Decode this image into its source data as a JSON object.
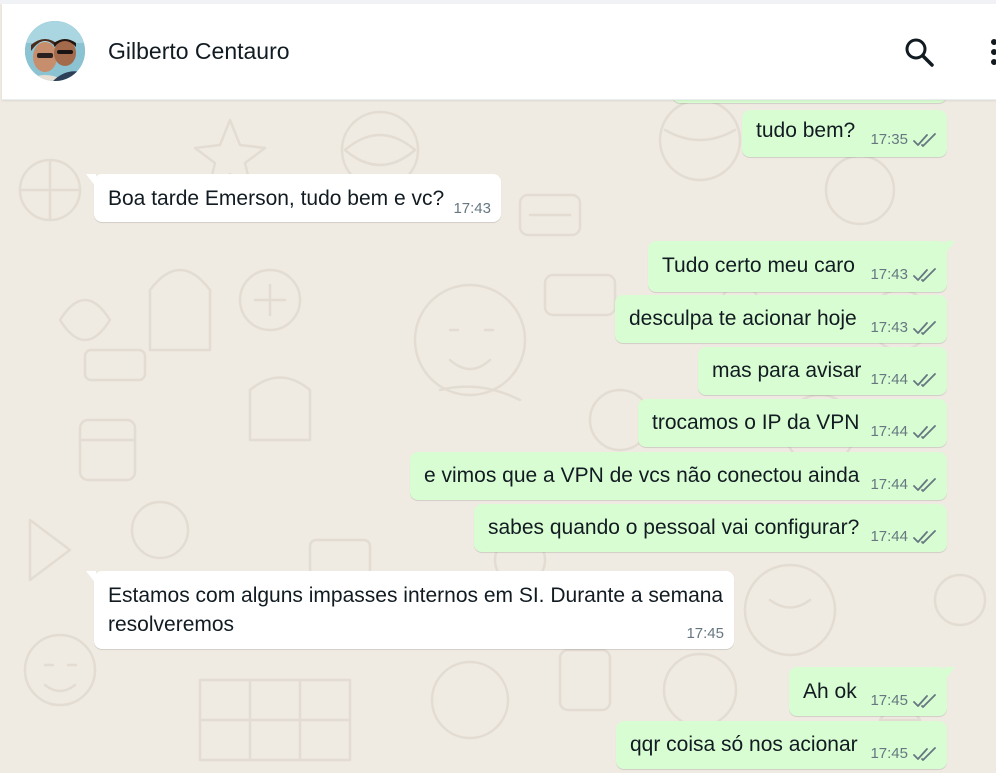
{
  "contact": {
    "name": "Gilberto Centauro"
  },
  "icons": {
    "search": "search-icon",
    "menu": "kebab-menu-icon",
    "read_receipt": "double-check-icon"
  },
  "colors": {
    "outgoing": "#d9fdd3",
    "incoming": "#ffffff",
    "read_ticks": "#667781",
    "wallpaper": "#efeae2"
  },
  "messages": [
    {
      "direction": "out",
      "text": "tudo bem?",
      "time": "17:35",
      "read": true
    },
    {
      "direction": "in",
      "text": "Boa tarde Emerson, tudo bem e vc?",
      "time": "17:43"
    },
    {
      "direction": "out",
      "text": "Tudo certo meu caro",
      "time": "17:43",
      "read": true
    },
    {
      "direction": "out",
      "text": "desculpa te acionar hoje",
      "time": "17:43",
      "read": true
    },
    {
      "direction": "out",
      "text": "mas para avisar",
      "time": "17:44",
      "read": true
    },
    {
      "direction": "out",
      "text": "trocamos o IP da VPN",
      "time": "17:44",
      "read": true
    },
    {
      "direction": "out",
      "text": "e vimos que a VPN de vcs não conectou ainda",
      "time": "17:44",
      "read": true
    },
    {
      "direction": "out",
      "text": "sabes quando o pessoal vai configurar?",
      "time": "17:44",
      "read": true
    },
    {
      "direction": "in",
      "text_line1": "Estamos com alguns impasses internos em SI. Durante a semana",
      "text_line2": "resolveremos",
      "time": "17:45"
    },
    {
      "direction": "out",
      "text": "Ah ok",
      "time": "17:45",
      "read": true
    },
    {
      "direction": "out",
      "text": "qqr coisa só nos acionar",
      "time": "17:45",
      "read": true
    }
  ]
}
